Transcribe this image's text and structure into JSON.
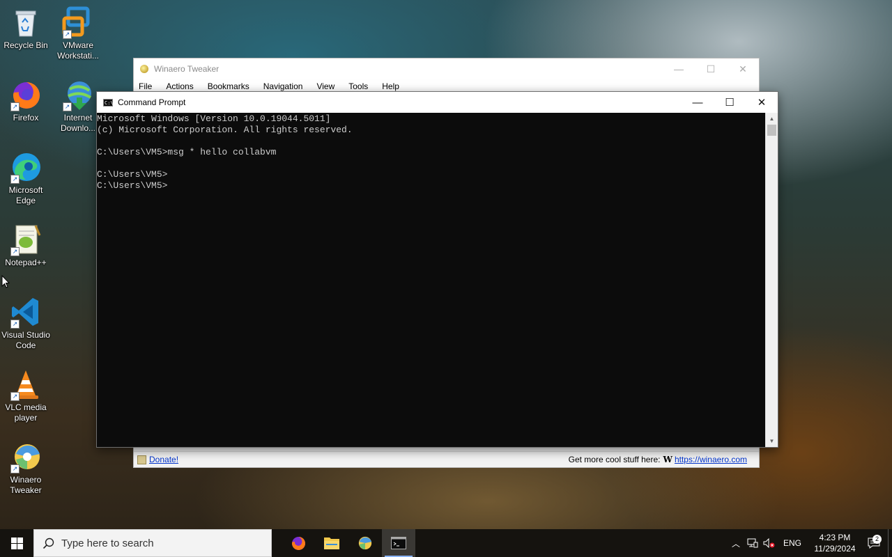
{
  "desktop": {
    "icons": [
      {
        "label": "Recycle Bin",
        "icon": "recycle-bin-icon"
      },
      {
        "label": "VMware Workstati...",
        "icon": "vmware-icon"
      },
      {
        "label": "Firefox",
        "icon": "firefox-icon"
      },
      {
        "label": "Internet Downlo...",
        "icon": "internet-download-manager-icon"
      },
      {
        "label": "Microsoft Edge",
        "icon": "edge-icon"
      },
      {
        "label": "Notepad++",
        "icon": "notepadpp-icon"
      },
      {
        "label": "Visual Studio Code",
        "icon": "vscode-icon"
      },
      {
        "label": "VLC media player",
        "icon": "vlc-icon"
      },
      {
        "label": "Winaero Tweaker",
        "icon": "winaero-icon"
      }
    ]
  },
  "winaero": {
    "title": "Winaero Tweaker",
    "menu": [
      "File",
      "Actions",
      "Bookmarks",
      "Navigation",
      "View",
      "Tools",
      "Help"
    ],
    "status": {
      "donate": "Donate!",
      "more_text": "Get more cool stuff here:",
      "w_glyph": "W",
      "link": "https://winaero.com"
    }
  },
  "cmd": {
    "title": "Command Prompt",
    "lines": [
      "Microsoft Windows [Version 10.0.19044.5011]",
      "(c) Microsoft Corporation. All rights reserved.",
      "",
      "C:\\Users\\VM5>msg * hello collabvm",
      "",
      "C:\\Users\\VM5>",
      "C:\\Users\\VM5>"
    ]
  },
  "taskbar": {
    "search_placeholder": "Type here to search",
    "apps": [
      "firefox-icon",
      "file-explorer-icon",
      "winaero-icon",
      "command-prompt-icon"
    ],
    "tray": {
      "lang": "ENG",
      "time": "4:23 PM",
      "date": "11/29/2024",
      "notification_count": "2"
    }
  },
  "colors": {
    "console_bg": "#0c0c0c",
    "console_fg": "#cccccc",
    "taskbar_bg": "#15130f",
    "link": "#0033cc"
  }
}
